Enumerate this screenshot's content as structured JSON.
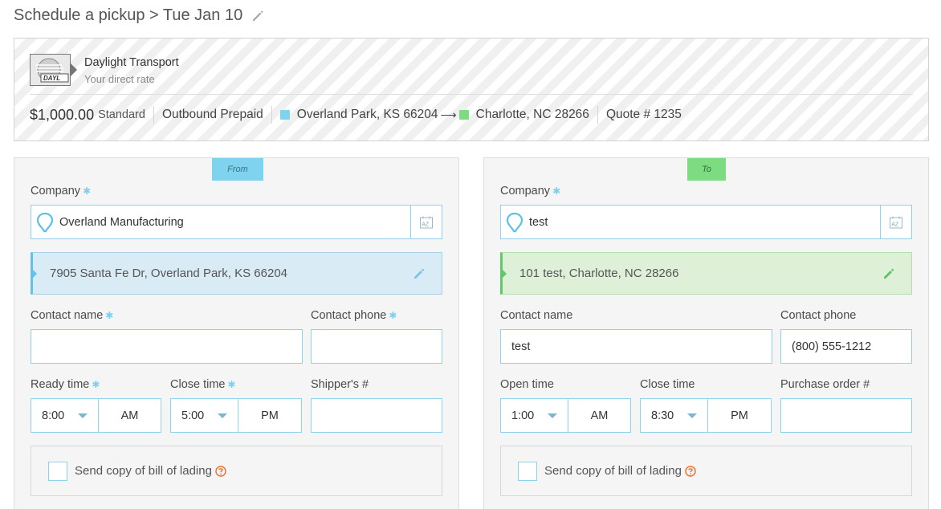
{
  "header": {
    "title": "Schedule a pickup > Tue Jan 10",
    "edit_icon": "pencil-icon"
  },
  "carrier": {
    "name": "Daylight Transport",
    "subtitle": "Your direct rate",
    "logo_text": "DAYL",
    "price": "$1,000.00",
    "service": "Standard",
    "terms": "Outbound Prepaid",
    "origin": "Overland Park, KS 66204",
    "destination": "Charlotte, NC 28266",
    "quote": "Quote # 1235",
    "origin_color": "#7fd3ee",
    "destination_color": "#7ddc82"
  },
  "from": {
    "tag": "From",
    "company_label": "Company",
    "company_value": "Overland Manufacturing",
    "address": "7905 Santa Fe Dr, Overland Park, KS 66204",
    "contact_name_label": "Contact name",
    "contact_name_value": "",
    "contact_phone_label": "Contact phone",
    "contact_phone_value": "",
    "time1_label": "Ready time",
    "time1_value": "8:00",
    "time1_ampm": "AM",
    "time2_label": "Close time",
    "time2_value": "5:00",
    "time2_ampm": "PM",
    "ref_label": "Shipper's #",
    "ref_value": "",
    "bol_label": "Send copy of bill of lading"
  },
  "to": {
    "tag": "To",
    "company_label": "Company",
    "company_value": "test",
    "address": "101 test, Charlotte, NC 28266",
    "contact_name_label": "Contact name",
    "contact_name_value": "test",
    "contact_phone_label": "Contact phone",
    "contact_phone_value": "(800) 555-1212",
    "time1_label": "Open time",
    "time1_value": "1:00",
    "time1_ampm": "AM",
    "time2_label": "Close time",
    "time2_value": "8:30",
    "time2_ampm": "PM",
    "ref_label": "Purchase order #",
    "ref_value": "",
    "bol_label": "Send copy of bill of lading"
  },
  "required_marker": "✱",
  "az_label": "AZ",
  "icons": {
    "pin": "map-pin-icon",
    "az": "address-book-icon",
    "edit": "pencil-icon",
    "help": "question-icon"
  }
}
